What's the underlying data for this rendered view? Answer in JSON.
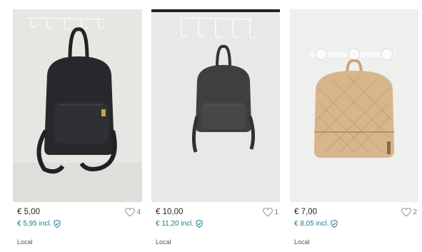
{
  "listings": [
    {
      "price": "€ 5,00",
      "price_incl": "€ 5,95 incl.",
      "likes": "4",
      "location": "Local",
      "colors": {
        "bag": "#26282b",
        "wall": "#e6e6e3"
      }
    },
    {
      "price": "€ 10,00",
      "price_incl": "€ 11,20 incl.",
      "likes": "1",
      "location": "Local",
      "colors": {
        "bag": "#3d3f40",
        "wall": "#e8e8e6"
      }
    },
    {
      "price": "€ 7,00",
      "price_incl": "€ 8,05 incl.",
      "likes": "2",
      "location": "Local",
      "colors": {
        "bag": "#d9b58b",
        "wall": "#efefee"
      }
    }
  ],
  "colors": {
    "accent": "#1c7a8c",
    "text": "#222222",
    "muted": "#777777"
  },
  "icons": {
    "like": "heart-outline-icon",
    "protection": "shield-check-icon"
  }
}
